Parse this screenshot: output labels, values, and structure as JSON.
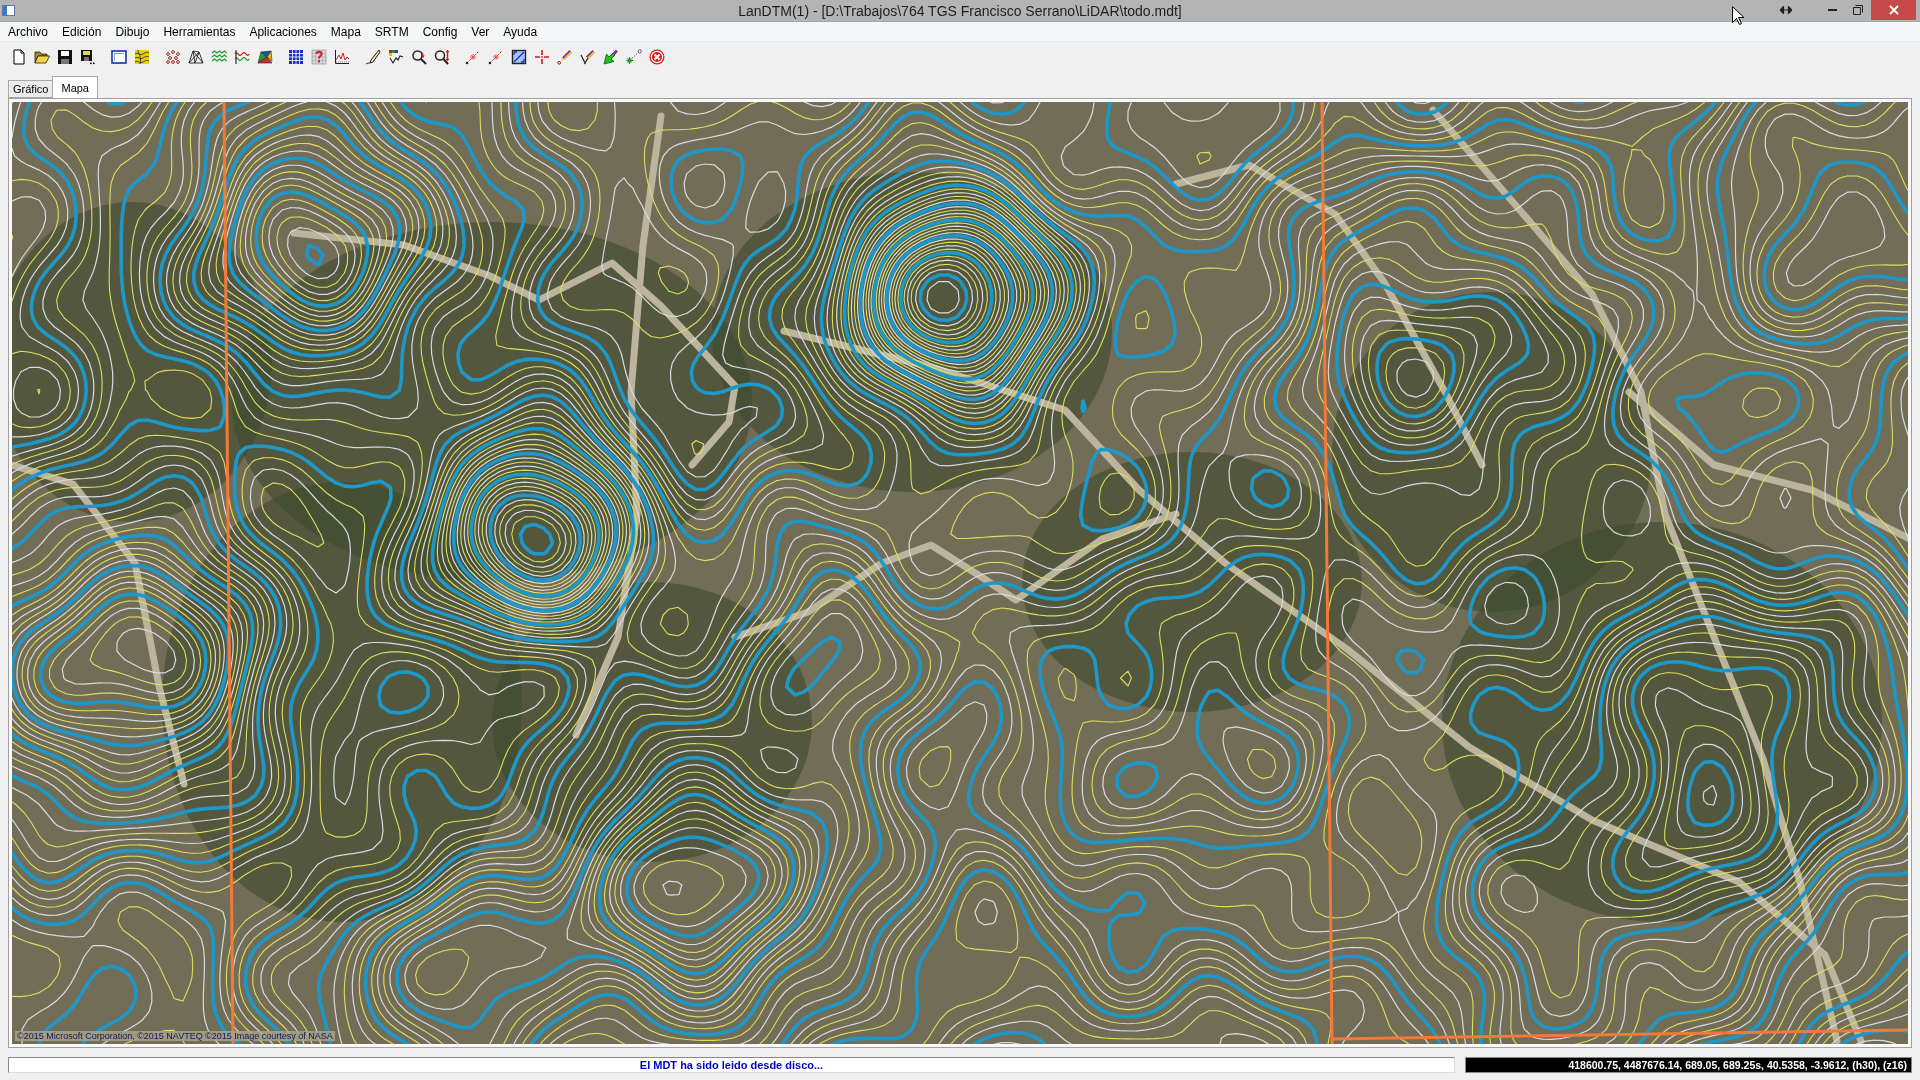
{
  "window": {
    "title": "LanDTM(1) - [D:\\Trabajos\\764 TGS Francisco Serrano\\LiDAR\\todo.mdt]"
  },
  "menu": [
    "Archivo",
    "Edición",
    "Dibujo",
    "Herramientas",
    "Aplicaciones",
    "Mapa",
    "SRTM",
    "Config",
    "Ver",
    "Ayuda"
  ],
  "tabs": [
    {
      "label": "Gráfico",
      "selected": false
    },
    {
      "label": "Mapa",
      "selected": true
    }
  ],
  "map": {
    "attribution": "©2015 Microsoft Corporation, ©2015 NAVTEQ ©2015 Image courtesy of NASA"
  },
  "status_bar": {
    "message": "El MDT ha sido leido desde disco...",
    "coordinates": "418600.75, 4487676.14, 689.05, 689.25s, 40.5358, -3.9612, (h30), (z16)"
  }
}
